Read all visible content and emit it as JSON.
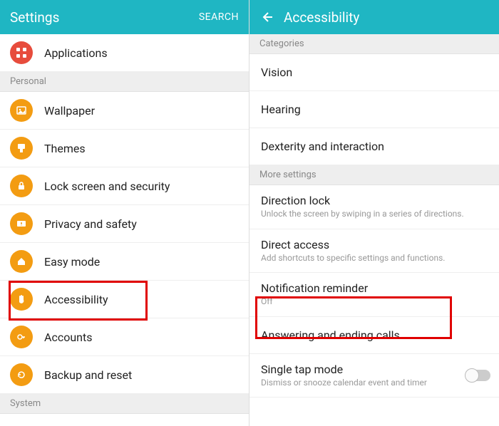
{
  "left": {
    "title": "Settings",
    "search": "SEARCH",
    "items": [
      {
        "label": "Applications",
        "icon": "grid",
        "color": "red"
      }
    ],
    "personal_header": "Personal",
    "personal": [
      {
        "label": "Wallpaper",
        "icon": "image"
      },
      {
        "label": "Themes",
        "icon": "brush"
      },
      {
        "label": "Lock screen and security",
        "icon": "lock"
      },
      {
        "label": "Privacy and safety",
        "icon": "warning"
      },
      {
        "label": "Easy mode",
        "icon": "home"
      },
      {
        "label": "Accessibility",
        "icon": "hand"
      },
      {
        "label": "Accounts",
        "icon": "key"
      },
      {
        "label": "Backup and reset",
        "icon": "refresh"
      }
    ],
    "system_header": "System"
  },
  "right": {
    "title": "Accessibility",
    "categories_header": "Categories",
    "categories": [
      {
        "label": "Vision"
      },
      {
        "label": "Hearing"
      },
      {
        "label": "Dexterity and interaction"
      }
    ],
    "more_header": "More settings",
    "more": [
      {
        "label": "Direction lock",
        "sub": "Unlock the screen by swiping in a series of directions."
      },
      {
        "label": "Direct access",
        "sub": "Add shortcuts to specific settings and functions."
      },
      {
        "label": "Notification reminder",
        "sub": "Off"
      },
      {
        "label": "Answering and ending calls",
        "sub": ""
      },
      {
        "label": "Single tap mode",
        "sub": "Dismiss or snooze calendar event and timer"
      }
    ]
  }
}
